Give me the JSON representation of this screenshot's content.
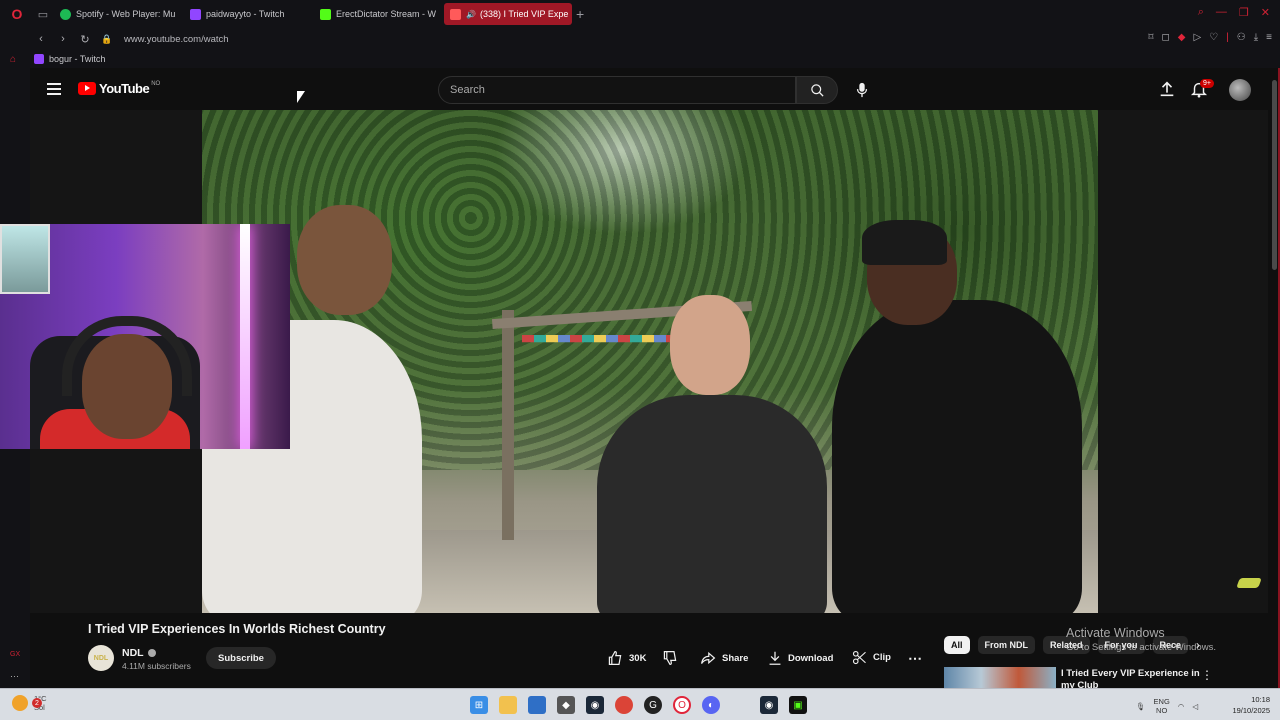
{
  "browser": {
    "tabs": [
      {
        "label": "Spotify - Web Player: Mu",
        "color": "#1db954",
        "icon": "spotify-icon"
      },
      {
        "label": "paidwayyto - Twitch",
        "color": "#9146ff",
        "icon": "twitch-icon"
      },
      {
        "label": "ErectDictator Stream - W",
        "color": "#53fc18",
        "icon": "kick-icon"
      },
      {
        "label": "(338) I Tried VIP Expe",
        "color": "#ff0000",
        "icon": "youtube-icon"
      }
    ],
    "url": "www.youtube.com/watch",
    "bookmark": "bogur - Twitch"
  },
  "youtube": {
    "logo_text": "YouTube",
    "region": "NO",
    "search_placeholder": "Search",
    "notif_badge": "9+"
  },
  "video": {
    "title": "I Tried VIP Experiences In Worlds Richest Country",
    "channel": "NDL",
    "channel_avatar_text": "NDL",
    "subscribers": "4.11M subscribers",
    "subscribe_label": "Subscribe",
    "likes": "30K",
    "share_label": "Share",
    "download_label": "Download",
    "clip_label": "Clip"
  },
  "chips": [
    "All",
    "From NDL",
    "Related",
    "For you",
    "Rece"
  ],
  "recommendation": {
    "title": "I Tried Every VIP Experience in my Club"
  },
  "watermark": {
    "line1": "Activate Windows",
    "line2": "Go to Settings to activate Windows."
  },
  "taskbar": {
    "weather_temp": "1°C",
    "weather_cond": "Sol",
    "weather_badge": "2",
    "lang1": "ENG",
    "lang2": "NO",
    "time": "10:18",
    "date": "19/10/2025"
  },
  "sidebar": {
    "gx_label": "GX"
  }
}
